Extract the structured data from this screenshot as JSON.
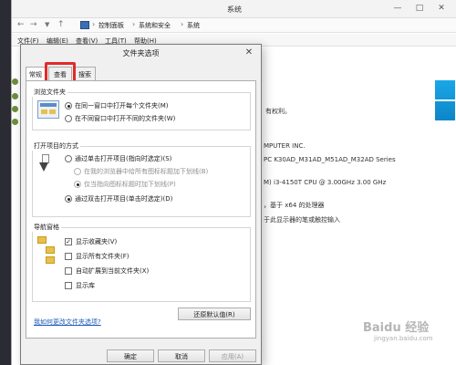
{
  "bg_window": {
    "title": "系统",
    "breadcrumb": [
      "控制面板",
      "系统和安全",
      "系统"
    ],
    "menu": [
      "文件(F)",
      "编辑(E)",
      "查看(V)",
      "工具(T)",
      "帮助(H)"
    ],
    "text_rights": "有权利。",
    "text_manufacturer": "MPUTER INC.",
    "text_model": "PC K30AD_M31AD_M51AD_M32AD Series",
    "text_cpu": "M) i3-4150T CPU @ 3.00GHz   3.00 GHz",
    "text_os_type": "，基于 x64 的处理器",
    "text_pen": "于此显示器的笔或触控输入"
  },
  "dialog": {
    "title": "文件夹选项",
    "tabs": [
      "常规",
      "查看",
      "搜索"
    ],
    "active_tab": "常规",
    "browse_group": {
      "title": "浏览文件夹",
      "options": [
        "在同一窗口中打开每个文件夹(M)",
        "在不同窗口中打开不同的文件夹(W)"
      ],
      "selected": 0
    },
    "click_group": {
      "title": "打开项目的方式",
      "options": [
        "通过单击打开项目(指向时选定)(S)",
        "在我的浏览器中给所有图标标题加下划线(B)",
        "仅当指向图标标题时加下划线(P)",
        "通过双击打开项目(单击时选定)(D)"
      ],
      "selected": 3
    },
    "nav_group": {
      "title": "导航窗格",
      "options": [
        {
          "label": "显示收藏夹(V)",
          "checked": true
        },
        {
          "label": "显示所有文件夹(F)",
          "checked": false
        },
        {
          "label": "自动扩展到当前文件夹(X)",
          "checked": false
        },
        {
          "label": "显示库",
          "checked": false
        }
      ]
    },
    "restore_button": "还原默认值(R)",
    "help_link": "我如何更改文件夹选项?",
    "ok_button": "确定",
    "cancel_button": "取消",
    "apply_button": "应用(A)"
  },
  "watermark": {
    "main": "Baidu 经验",
    "sub": "jingyan.baidu.com"
  },
  "colors": {
    "highlight_box": "#e12a2a",
    "link": "#1e5bb8",
    "win_logo": "#1aa7e6"
  }
}
